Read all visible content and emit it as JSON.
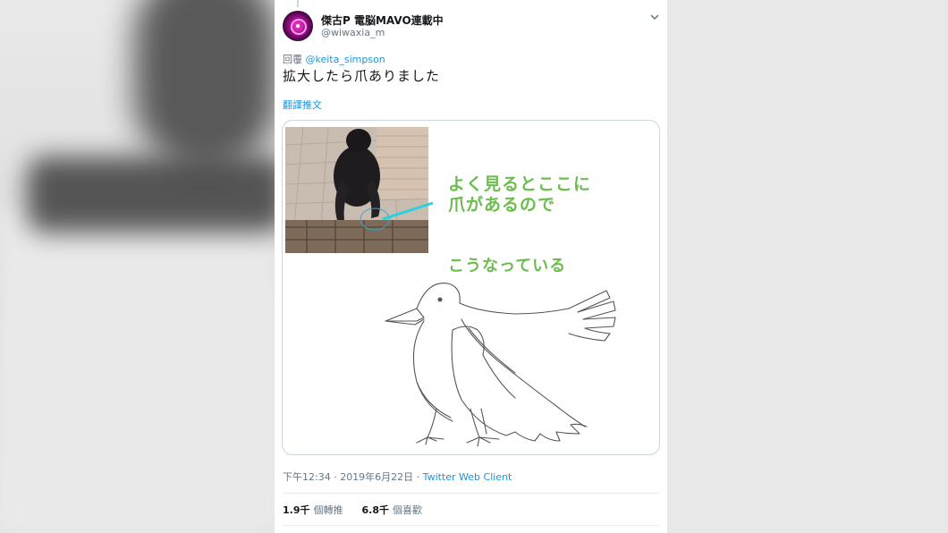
{
  "tweet": {
    "display_name": "傑古P 電脳MAVO連載中",
    "handle": "@wiwaxia_m",
    "reply_prefix": "回覆",
    "reply_to": "@keita_simpson",
    "text": "拡大したら爪ありました",
    "translate_label": "翻譯推文",
    "image_annotation_line1": "よく見るとここに",
    "image_annotation_line2": "爪があるので",
    "image_annotation_line3": "こうなっている",
    "timestamp": "下午12:34 · 2019年6月22日 · ",
    "client": "Twitter Web Client",
    "retweets_count": "1.9千",
    "retweets_label": "個轉推",
    "likes_count": "6.8千",
    "likes_label": "個喜歡"
  },
  "colors": {
    "link": "#1b95e0",
    "annotation": "#6cbc4f",
    "secondary_text": "#657786"
  },
  "icons": {
    "caret": "chevron-down-icon"
  }
}
